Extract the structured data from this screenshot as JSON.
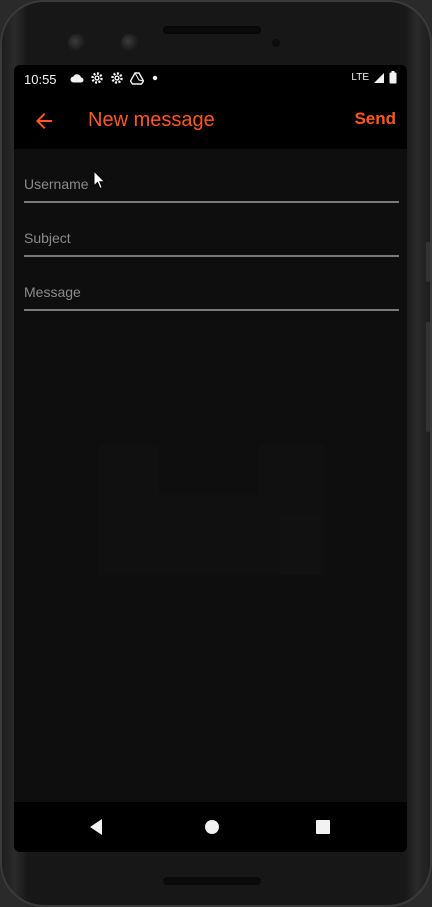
{
  "status_bar": {
    "time": "10:55",
    "network": "LTE",
    "left_icons": [
      "cloud-icon",
      "gear-icon",
      "gear-icon",
      "drive-icon",
      "dot-icon"
    ],
    "right_icons": [
      "signal-icon",
      "battery-icon"
    ]
  },
  "app_bar": {
    "title": "New message",
    "send_label": "Send",
    "accent_color": "#ff5722"
  },
  "form": {
    "username": {
      "placeholder": "Username",
      "value": ""
    },
    "subject": {
      "placeholder": "Subject",
      "value": ""
    },
    "message": {
      "placeholder": "Message",
      "value": ""
    }
  },
  "nav_bar": {
    "buttons": [
      "back-triangle-icon",
      "home-circle-icon",
      "recents-square-icon"
    ]
  }
}
